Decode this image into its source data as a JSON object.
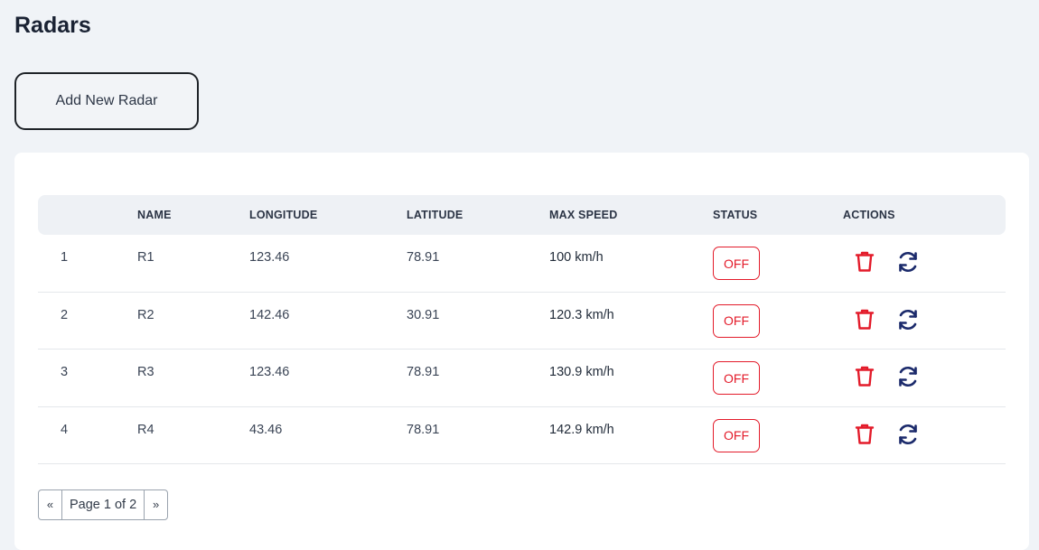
{
  "page": {
    "title": "Radars"
  },
  "toolbar": {
    "add_label": "Add New Radar"
  },
  "table": {
    "headers": [
      "",
      "NAME",
      "LONGITUDE",
      "LATITUDE",
      "MAX SPEED",
      "STATUS",
      "ACTIONS"
    ],
    "rows": [
      {
        "index": "1",
        "name": "R1",
        "longitude": "123.46",
        "latitude": "78.91",
        "max_speed": "100 km/h",
        "status": "OFF"
      },
      {
        "index": "2",
        "name": "R2",
        "longitude": "142.46",
        "latitude": "30.91",
        "max_speed": "120.3 km/h",
        "status": "OFF"
      },
      {
        "index": "3",
        "name": "R3",
        "longitude": "123.46",
        "latitude": "78.91",
        "max_speed": "130.9 km/h",
        "status": "OFF"
      },
      {
        "index": "4",
        "name": "R4",
        "longitude": "43.46",
        "latitude": "78.91",
        "max_speed": "142.9 km/h",
        "status": "OFF"
      }
    ],
    "action_icons": [
      "trash-icon",
      "refresh-icon"
    ]
  },
  "pagination": {
    "prev": "«",
    "label": "Page 1 of 2",
    "next": "»"
  },
  "colors": {
    "status_off": "#e31b2a",
    "delete": "#e31b2a",
    "refresh": "#1b2a6b",
    "background": "#f0f3f7"
  }
}
